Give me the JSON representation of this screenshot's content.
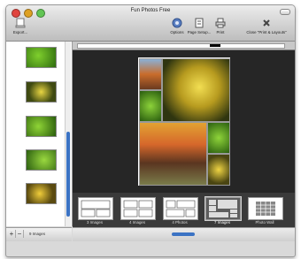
{
  "window": {
    "title": "Fun Photos Free"
  },
  "toolbar": {
    "export_label": "Export...",
    "options_label": "Options",
    "page_setup_label": "Page Setup...",
    "print_label": "Print",
    "close_label": "Close \"Print & Layouts\""
  },
  "sidebar": {
    "image_count": "9 Images"
  },
  "layouts": [
    {
      "label": "3 Images"
    },
    {
      "label": "4 Images"
    },
    {
      "label": "4 Photos"
    },
    {
      "label": "7 Images"
    },
    {
      "label": "Photo Wall"
    }
  ],
  "colors": {
    "accent": "#3b73c4",
    "canvas_bg": "#262626"
  }
}
